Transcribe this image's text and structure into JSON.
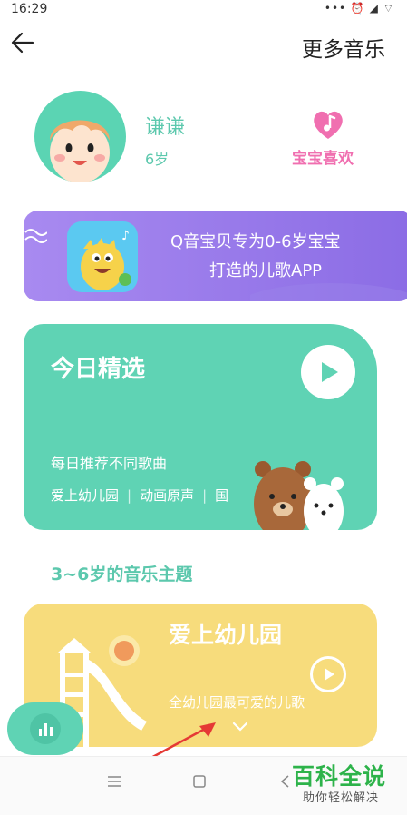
{
  "status_bar": {
    "time": "16:29",
    "icons_text": "••• ⏰ ◢ ⌔"
  },
  "header": {
    "title": "更多音乐"
  },
  "profile": {
    "name": "谦谦",
    "age": "6岁",
    "like_label": "宝宝喜欢"
  },
  "banner": {
    "line1": "Q音宝贝专为0-6岁宝宝",
    "line2": "打造的儿歌APP"
  },
  "today": {
    "title": "今日精选",
    "subtitle": "每日推荐不同歌曲",
    "tags": [
      "爱上幼儿园",
      "动画原声",
      "国"
    ]
  },
  "section": {
    "title": "3~6岁的音乐主题"
  },
  "theme_card": {
    "title": "爱上幼儿园",
    "subtitle": "全幼儿园最可爱的儿歌"
  },
  "watermark": {
    "main": "百科全说",
    "sub": "助你轻松解决"
  },
  "colors": {
    "accent": "#5fd3b4",
    "pink": "#f06fb0",
    "banner": "#9b7ded",
    "theme": "#f7dc7c"
  }
}
